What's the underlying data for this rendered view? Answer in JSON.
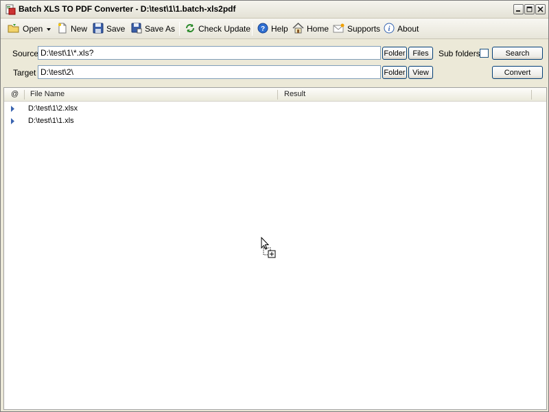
{
  "window": {
    "title": "Batch XLS TO PDF Converter - D:\\test\\1\\1.batch-xls2pdf",
    "controls": {
      "minimize": "_",
      "maximize": "□",
      "close": "✕"
    }
  },
  "toolbar": {
    "open": "Open",
    "new": "New",
    "save": "Save",
    "save_as": "Save As",
    "check_update": "Check Update",
    "help": "Help",
    "home": "Home",
    "supports": "Supports",
    "about": "About"
  },
  "source": {
    "label": "Source",
    "value": "D:\\test\\1\\*.xls?",
    "folder_button": "Folder",
    "files_button": "Files"
  },
  "target": {
    "label": "Target",
    "value": "D:\\test\\2\\",
    "folder_button": "Folder",
    "view_button": "View"
  },
  "options": {
    "subfolders_label": "Sub folders",
    "subfolders_checked": false,
    "search_button": "Search",
    "convert_button": "Convert"
  },
  "list": {
    "columns": {
      "status": "@",
      "file_name": "File Name",
      "result": "Result"
    },
    "rows": [
      {
        "name": "D:\\test\\1\\2.xlsx",
        "result": ""
      },
      {
        "name": "D:\\test\\1\\1.xls",
        "result": ""
      }
    ]
  },
  "colors": {
    "window_bg": "#ece9d8",
    "field_border": "#7f9db9",
    "button_border": "#003c74",
    "row_arrow": "#3a64b0"
  }
}
